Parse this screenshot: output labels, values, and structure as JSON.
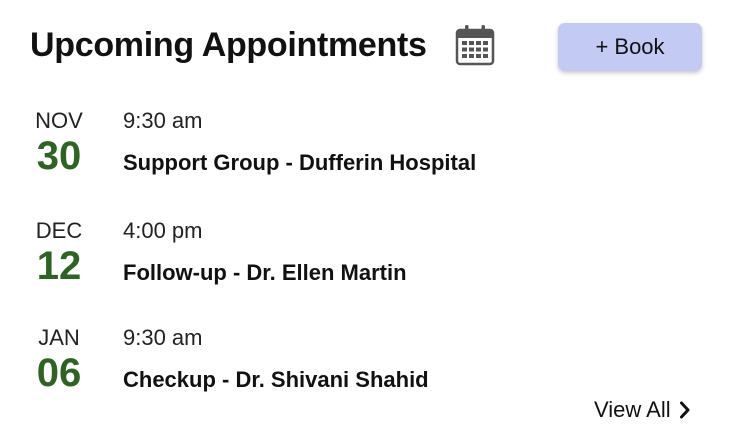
{
  "header": {
    "title": "Upcoming Appointments",
    "calendar_icon": "calendar-icon",
    "book_button_label": "+ Book"
  },
  "appointments": [
    {
      "month": "NOV",
      "day": "30",
      "time": "9:30 am",
      "title": "Support Group - Dufferin Hospital"
    },
    {
      "month": "DEC",
      "day": "12",
      "time": "4:00 pm",
      "title": "Follow-up - Dr. Ellen Martin"
    },
    {
      "month": "JAN",
      "day": "06",
      "time": "9:30 am",
      "title": "Checkup - Dr. Shivani Shahid"
    }
  ],
  "footer": {
    "view_all_label": "View All",
    "view_all_icon": "chevron-right-icon"
  },
  "colors": {
    "accent_button": "#c3cbf5",
    "day_number": "#2f6324",
    "text": "#111111"
  }
}
